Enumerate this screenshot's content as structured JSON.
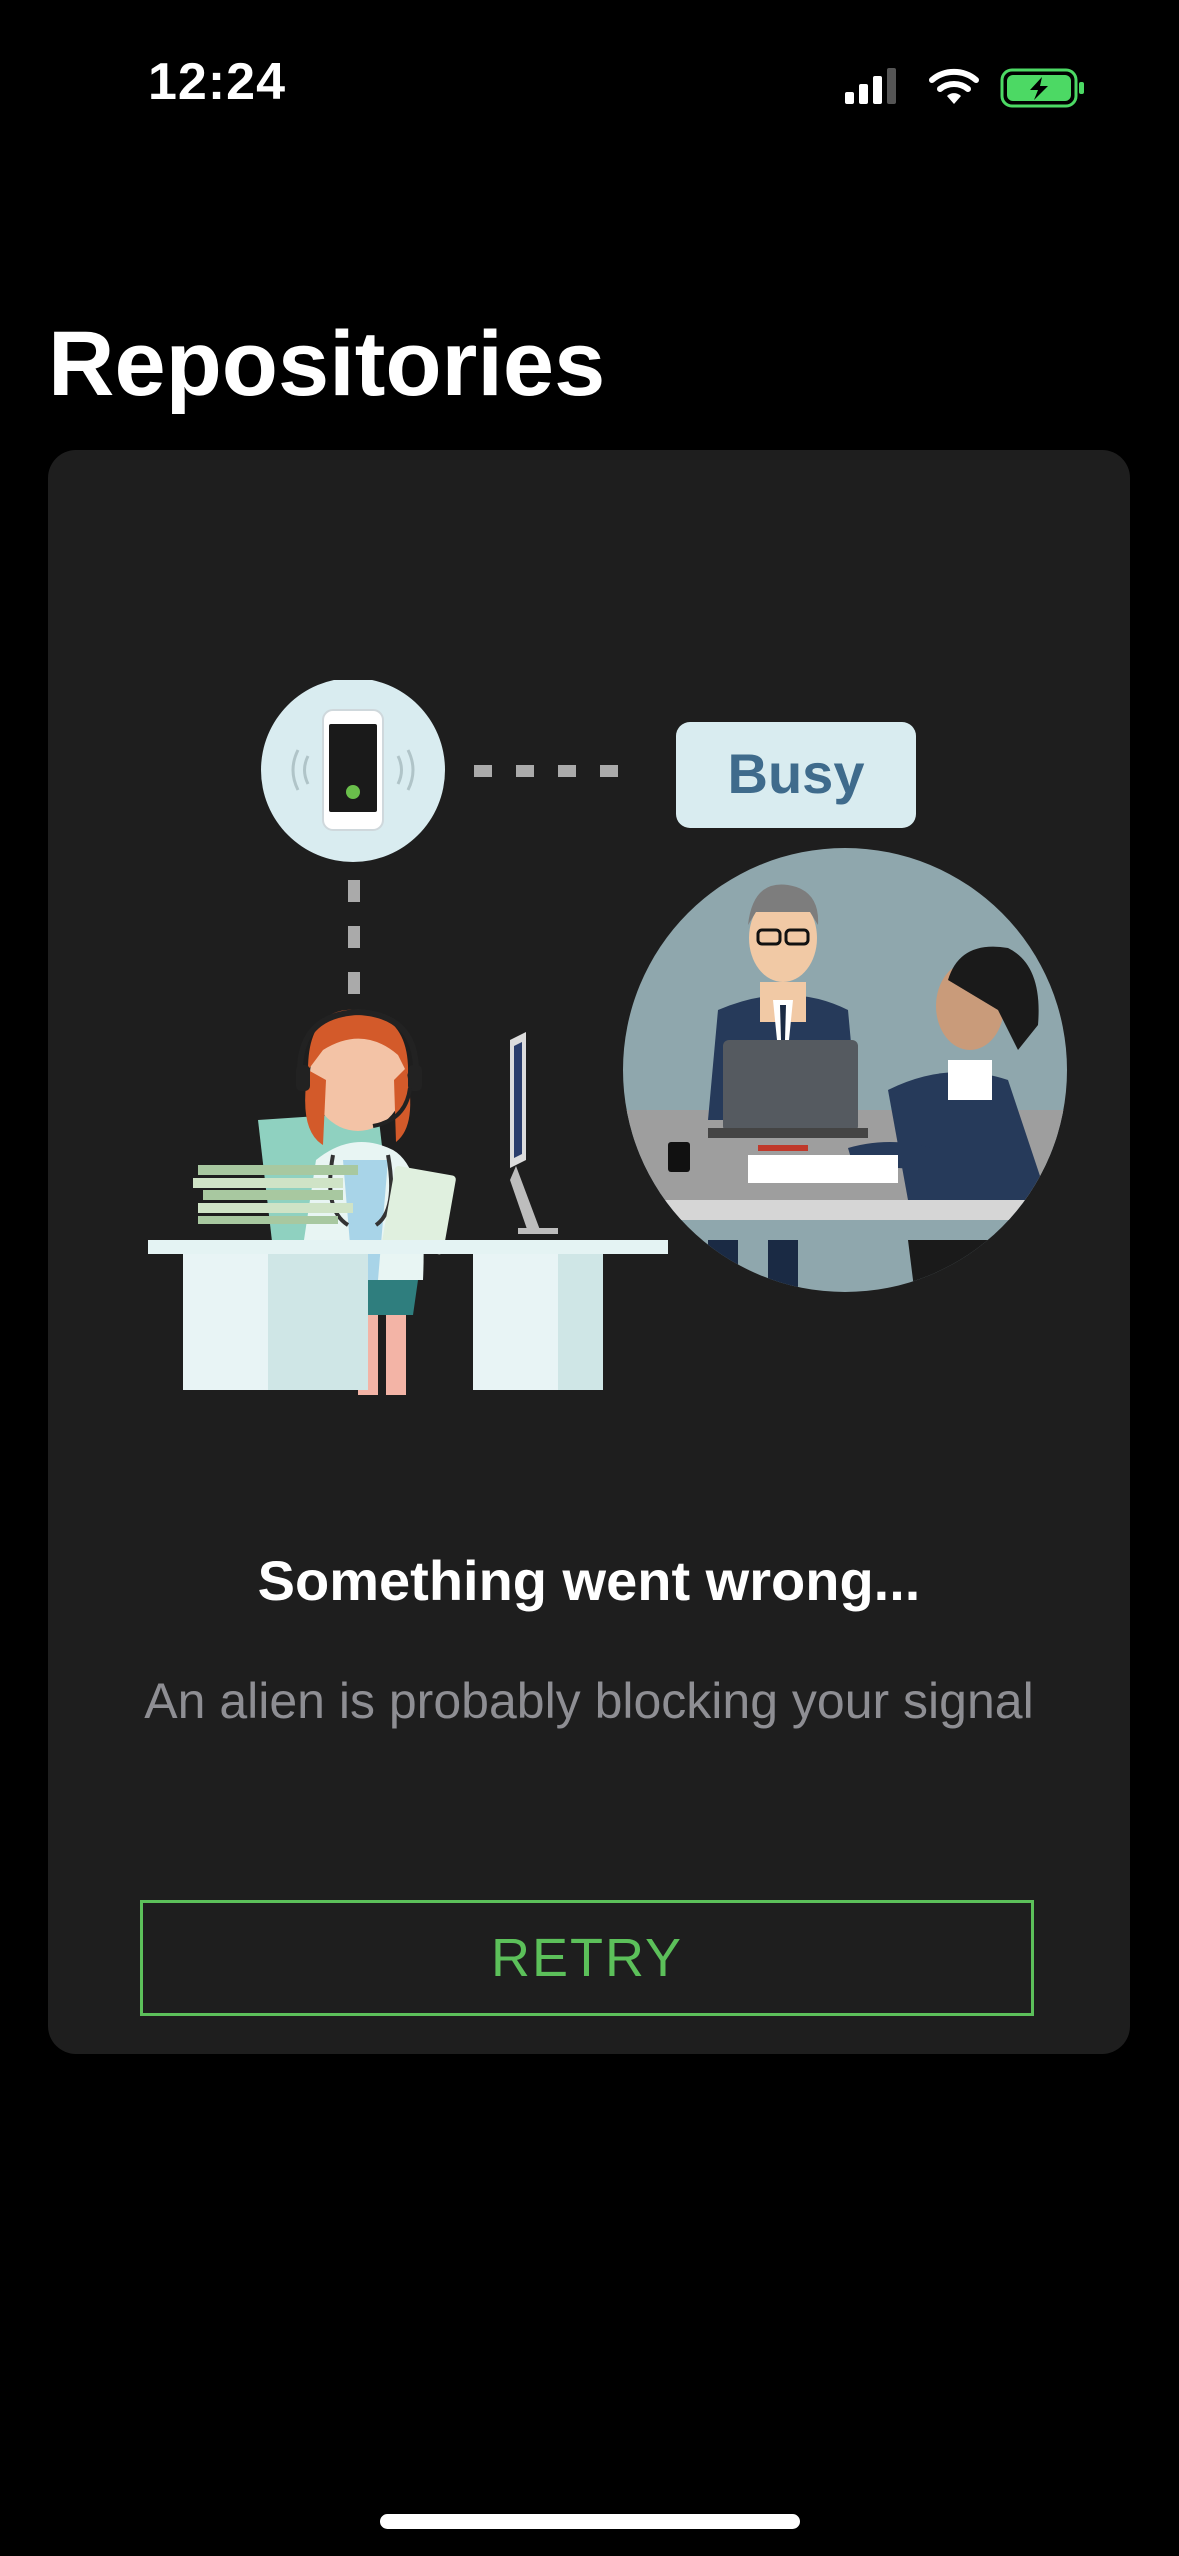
{
  "status_bar": {
    "time": "12:24",
    "icons": [
      "cellular-signal-icon",
      "wifi-icon",
      "battery-charging-icon"
    ],
    "battery_color": "#4cd964"
  },
  "header": {
    "title": "Repositories"
  },
  "error_state": {
    "illustration": {
      "name": "busy-call-illustration",
      "badge_label": "Busy"
    },
    "title": "Something went wrong...",
    "subtitle": "An alien is probably blocking your signal",
    "retry_label": "RETRY"
  },
  "colors": {
    "background": "#000000",
    "card": "#1e1e1e",
    "accent": "#5cc05a",
    "subtitle": "#8e8e93"
  }
}
